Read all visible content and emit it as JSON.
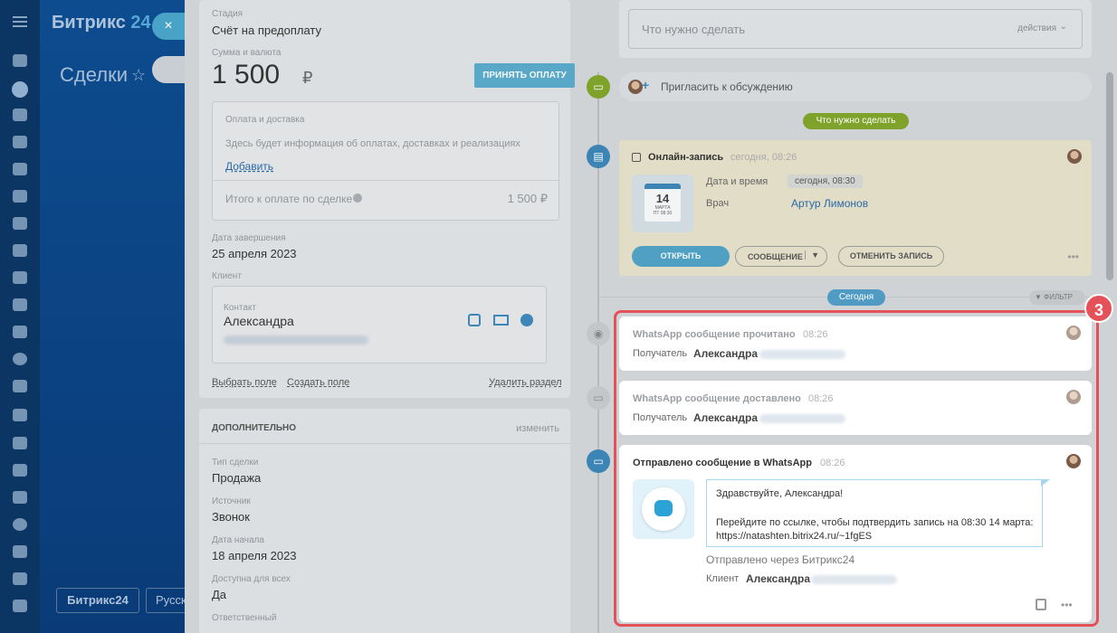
{
  "app": {
    "logo_text": "Битрикс",
    "logo_num": "24",
    "section_title": "Сделки",
    "b24_button": "Битрикс24",
    "lang_button": "Русский",
    "close_label": "×"
  },
  "deal": {
    "stage_label": "Стадия",
    "stage_value": "Счёт на предоплату",
    "amount_label": "Сумма и валюта",
    "amount_value": "1 500",
    "currency": "₽",
    "pay_button": "ПРИНЯТЬ ОПЛАТУ",
    "payment_title": "Оплата и доставка",
    "payment_hint": "Здесь будет информация об оплатах, доставках и реализациях",
    "add_link": "Добавить",
    "total_label": "Итого к оплате по сделке",
    "total_value": "1 500 ₽",
    "end_date_label": "Дата завершения",
    "end_date_value": "25 апреля 2023",
    "client_label": "Клиент",
    "contact_label": "Контакт",
    "contact_name": "Александра",
    "choose_field": "Выбрать поле",
    "create_field": "Создать поле",
    "delete_section": "Удалить раздел"
  },
  "extra": {
    "title": "ДОПОЛНИТЕЛЬНО",
    "edit": "изменить",
    "fields": [
      {
        "label": "Тип сделки",
        "value": "Продажа"
      },
      {
        "label": "Источник",
        "value": "Звонок"
      },
      {
        "label": "Дата начала",
        "value": "18 апреля 2023"
      },
      {
        "label": "Доступна для всех",
        "value": "Да"
      },
      {
        "label": "Ответственный",
        "value": ""
      }
    ]
  },
  "timeline": {
    "todo_placeholder": "Что нужно сделать",
    "actions": "действия",
    "invite": "Пригласить к обсуждению",
    "todo_pill": "Что нужно сделать",
    "booking": {
      "title": "Онлайн-запись",
      "time": "сегодня, 08:26",
      "date_label": "Дата и время",
      "date_value": "сегодня, 08:30",
      "doctor_label": "Врач",
      "doctor_value": "Артур Лимонов",
      "cal_day": "14",
      "cal_month": "МАРТА",
      "cal_weekday": "ПТ 08:30",
      "open": "ОТКРЫТЬ",
      "message": "СООБЩЕНИЕ",
      "cancel": "ОТМЕНИТЬ ЗАПИСЬ",
      "more": "•••"
    },
    "today_pill": "Сегодня",
    "filter": "ФИЛЬТР",
    "read": {
      "title": "WhatsApp сообщение прочитано",
      "time": "08:26",
      "recipient_label": "Получатель",
      "recipient_name": "Александра"
    },
    "delivered": {
      "title": "WhatsApp сообщение доставлено",
      "time": "08:26",
      "recipient_label": "Получатель",
      "recipient_name": "Александра"
    },
    "sent": {
      "title": "Отправлено сообщение в WhatsApp",
      "time": "08:26",
      "line1": "Здравствуйте, Александра!",
      "line2": "Перейдите по ссылке, чтобы подтвердить запись на 08:30 14 марта:",
      "line3": "https://natashten.bitrix24.ru/~1fgES",
      "via": "Отправлено через Битрикс24",
      "client_label": "Клиент",
      "client_name": "Александра",
      "more": "•••"
    },
    "step_badge": "3"
  }
}
